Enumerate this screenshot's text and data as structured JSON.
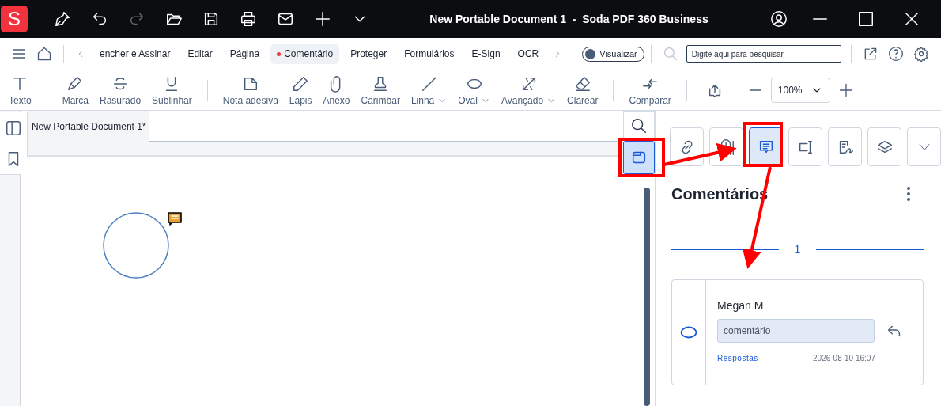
{
  "window": {
    "title": "New Portable Document 1  -  Soda PDF 360 Business",
    "logo": "S"
  },
  "menu_tabs": [
    {
      "label": "encher e Assinar",
      "selected": false
    },
    {
      "label": "Editar",
      "selected": false
    },
    {
      "label": "Página",
      "selected": false
    },
    {
      "label": "Comentário",
      "selected": true
    },
    {
      "label": "Proteger",
      "selected": false
    },
    {
      "label": "Formulários",
      "selected": false
    },
    {
      "label": "E-Sign",
      "selected": false
    },
    {
      "label": "OCR",
      "selected": false
    }
  ],
  "view_toggle": {
    "label": "Visualizar"
  },
  "search": {
    "placeholder": "Digite aqui para pesquisar"
  },
  "tool_groups": [
    [
      {
        "kind": "text",
        "label": "Texto",
        "menu": false
      }
    ],
    [
      {
        "kind": "highlight",
        "label": "Marca",
        "menu": false
      },
      {
        "kind": "strike",
        "label": "Rasurado",
        "menu": false
      },
      {
        "kind": "underline",
        "label": "Sublinhar",
        "menu": false
      }
    ],
    [
      {
        "kind": "note",
        "label": "Nota adesiva",
        "menu": false
      },
      {
        "kind": "pencil",
        "label": "Lápis",
        "menu": false
      },
      {
        "kind": "clip",
        "label": "Anexo",
        "menu": false
      },
      {
        "kind": "stamp",
        "label": "Carimbar",
        "menu": false
      },
      {
        "kind": "line",
        "label": "Linha",
        "menu": true
      },
      {
        "kind": "oval",
        "label": "Oval",
        "menu": true
      },
      {
        "kind": "advanced",
        "label": "Avançado",
        "menu": true
      },
      {
        "kind": "eraser",
        "label": "Clarear",
        "menu": false
      }
    ],
    [
      {
        "kind": "compare",
        "label": "Comparar",
        "menu": false
      }
    ]
  ],
  "zoom": {
    "value": "100%"
  },
  "document_tab": {
    "label": "New Portable Document 1*"
  },
  "right_rail": [
    {
      "kind": "search",
      "selected": false
    },
    {
      "kind": "panel",
      "selected": true
    }
  ],
  "panel_buttons": [
    {
      "kind": "link",
      "selected": false
    },
    {
      "kind": "clip",
      "selected": false
    },
    {
      "kind": "comment",
      "selected": true
    },
    {
      "kind": "field",
      "selected": false
    },
    {
      "kind": "sign",
      "selected": false
    },
    {
      "kind": "layers",
      "selected": false
    },
    {
      "kind": "more",
      "selected": false
    }
  ],
  "comments_panel": {
    "title": "Comentários",
    "page": "1",
    "comments": [
      {
        "author": "Megan M",
        "text": "comentário",
        "replies": "Respostas",
        "time": "2026-08-10 16:07"
      }
    ]
  }
}
